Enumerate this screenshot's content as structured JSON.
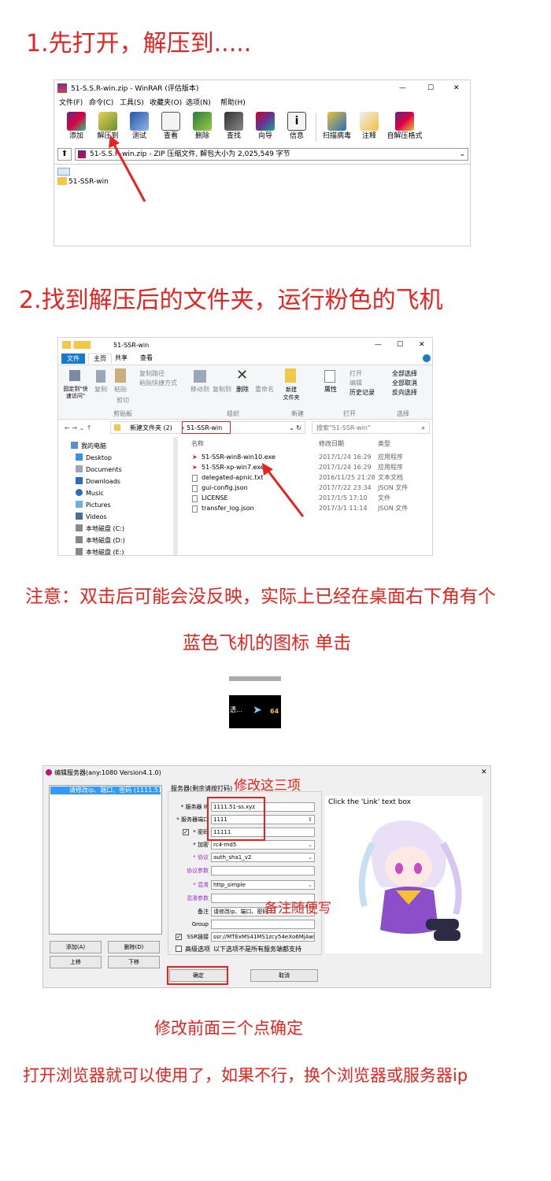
{
  "step1": {
    "title": "1.先打开，解压到....."
  },
  "winrar": {
    "title": "51-S.S.R-win.zip - WinRAR (评估版本)",
    "menu": [
      "文件(F)",
      "命令(C)",
      "工具(S)",
      "收藏夹(O)",
      "选项(N)",
      "帮助(H)"
    ],
    "toolbar": [
      "添加",
      "解压到",
      "测试",
      "查看",
      "删除",
      "查找",
      "向导",
      "信息",
      "扫描病毒",
      "注释",
      "自解压格式"
    ],
    "address": "51-S.S.R-win.zip - ZIP 压缩文件, 解包大小为 2,025,549 字节",
    "folder": "51-SSR-win",
    "controls": {
      "minimize": "—",
      "maximize": "☐",
      "close": "✕"
    }
  },
  "step2": {
    "title": "2.找到解压后的文件夹，运行粉色的飞机"
  },
  "explorer": {
    "title": "51-SSR-win",
    "tabs": [
      "文件",
      "主页",
      "共享",
      "查看"
    ],
    "ribbon": {
      "pin": "固定到\"快速访问\"",
      "copy": "复制",
      "paste": "粘贴",
      "copy_path": "复制路径",
      "paste_shortcut": "粘贴快捷方式",
      "cut": "剪切",
      "move_to": "移动到",
      "copy_to": "复制到",
      "delete": "删除",
      "rename": "重命名",
      "new_folder": "新建\n文件夹",
      "properties": "属性",
      "open": "打开",
      "edit": "编辑",
      "history": "历史记录",
      "select_all": "全部选择",
      "select_none": "全部取消",
      "invert": "反向选择",
      "groups": [
        "剪贴板",
        "组织",
        "新建",
        "打开",
        "选择"
      ]
    },
    "path": [
      "新建文件夹 (2)",
      "51-SSR-win"
    ],
    "search_placeholder": "搜索\"51-SSR-win\"",
    "nav": [
      "我的电脑",
      "Desktop",
      "Documents",
      "Downloads",
      "Music",
      "Pictures",
      "Videos",
      "本地磁盘 (C:)",
      "本地磁盘 (D:)",
      "本地磁盘 (E:)"
    ],
    "columns": [
      "名称",
      "修改日期",
      "类型"
    ],
    "files": [
      {
        "name": "51-SSR-win8-win10.exe",
        "date": "2017/1/24 16:29",
        "type": "应用程序",
        "kind": "plane"
      },
      {
        "name": "51-SSR-xp-win7.exe",
        "date": "2017/1/24 16:29",
        "type": "应用程序",
        "kind": "plane"
      },
      {
        "name": "delegated-apnic.txt",
        "date": "2016/11/25 21:28",
        "type": "文本文档",
        "kind": "doc"
      },
      {
        "name": "gui-config.json",
        "date": "2017/7/22 23:34",
        "type": "JSON 文件",
        "kind": "doc"
      },
      {
        "name": "LICENSE",
        "date": "2017/1/5 17:10",
        "type": "文件",
        "kind": "doc"
      },
      {
        "name": "transfer_log.json",
        "date": "2017/3/1 11:14",
        "type": "JSON 文件",
        "kind": "doc"
      }
    ]
  },
  "note": {
    "line1": "注意：双击后可能会没反映，实际上已经在桌面右下角有个",
    "line2": "蓝色飞机的图标 单击"
  },
  "tray": {
    "text": "透...",
    "num": "64"
  },
  "ssr": {
    "title": "编辑服务器(any:1080 Version4.1.0)",
    "list_item": "请修改ip、端口、密码 (1111.51",
    "group_label": "服务器(剩余请按打码)",
    "fields": [
      {
        "label": "* 服务器 IP",
        "value": "1111.51-ss.xyz"
      },
      {
        "label": "* 服务器端口",
        "value": "1111"
      },
      {
        "label": "* 密码",
        "value": "11111"
      },
      {
        "label": "* 加密",
        "value": "rc4-md5"
      },
      {
        "label": "* 协议",
        "value": "auth_sha1_v2"
      },
      {
        "label": "协议参数",
        "value": ""
      },
      {
        "label": "* 混淆",
        "value": "http_simple"
      },
      {
        "label": "混淆参数",
        "value": ""
      },
      {
        "label": "备注",
        "value": "请修改ip、端口、密码"
      },
      {
        "label": "Group",
        "value": ""
      },
      {
        "label": "SSR链接",
        "value": "ssr://MTExMS41MS1zcy54eXo6MjAwM"
      }
    ],
    "advanced": "高级选项",
    "advanced_note": "以下选项不是所有服务端都支持",
    "buttons": {
      "add": "添加(A)",
      "delete": "删除(D)",
      "up": "上移",
      "down": "下移",
      "ok": "确定",
      "cancel": "取消"
    },
    "link_hint": "Click the 'Link' text box",
    "annot_three": "修改这三项",
    "annot_note": "备注随便写",
    "close": "✕"
  },
  "caption_modify": "修改前面三个点确定",
  "caption_final": "打开浏览器就可以使用了，如果不行，换个浏览器或服务器ip",
  "colors": {
    "red": "#e8231f",
    "win_blue": "#1979ca",
    "select_blue": "#cce8ff"
  }
}
